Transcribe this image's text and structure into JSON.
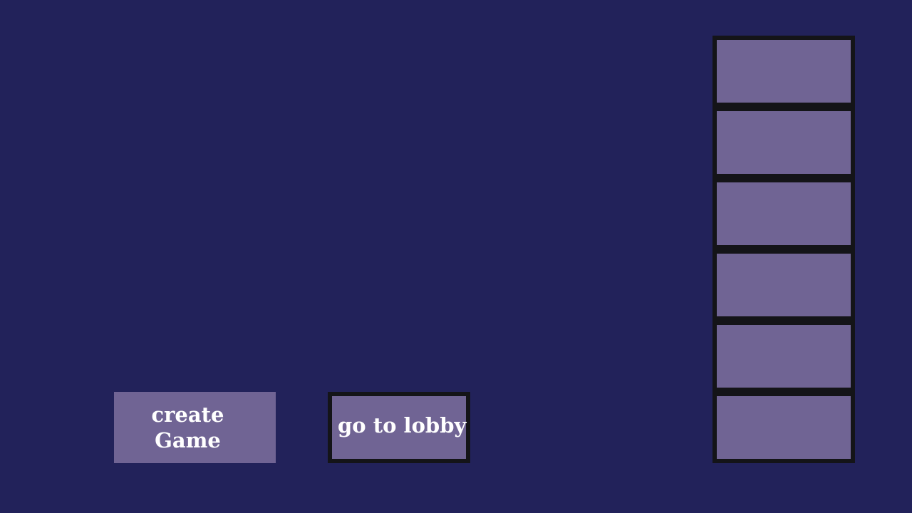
{
  "menu": {
    "create_game_label": "create Game",
    "go_to_lobby_label": "go to lobby"
  },
  "game_slots": [
    {
      "label": ""
    },
    {
      "label": ""
    },
    {
      "label": ""
    },
    {
      "label": ""
    },
    {
      "label": ""
    },
    {
      "label": ""
    }
  ],
  "colors": {
    "background": "#22225a",
    "button_fill": "#706494",
    "border": "#141418",
    "text": "#ffffff"
  }
}
